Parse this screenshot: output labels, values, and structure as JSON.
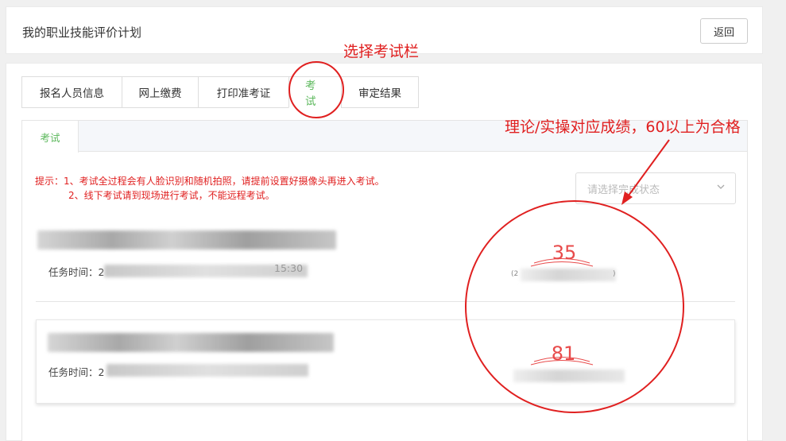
{
  "header": {
    "title": "我的职业技能评价计划",
    "back_label": "返回"
  },
  "tabs": [
    {
      "label": "报名人员信息",
      "active": false
    },
    {
      "label": "网上缴费",
      "active": false
    },
    {
      "label": "打印准考证",
      "active": false
    },
    {
      "label": "考试",
      "active": true
    },
    {
      "label": "审定结果",
      "active": false
    }
  ],
  "subtab": {
    "label": "考试"
  },
  "tips": {
    "line1": "提示：1、考试全过程会有人脸识别和随机拍照，请提前设置好摄像头再进入考试。",
    "line2": "2、线下考试请到现场进行考试，不能远程考试。"
  },
  "status_select": {
    "placeholder": "请选择完成状态",
    "chevron_icon": "chevron-down-icon"
  },
  "tasks": [
    {
      "time_label": "任务时间：2",
      "time_tail": "15:30",
      "score": "35",
      "score_paren_left": "(2",
      "score_paren_right": ")"
    },
    {
      "time_label": "任务时间：2",
      "score": "81"
    }
  ],
  "annotations": {
    "tab_hint": "选择考试栏",
    "score_hint": "理论/实操对应成绩，60以上为合格"
  },
  "colors": {
    "accent_green": "#5cb85c",
    "annotation_red": "#e02020",
    "score_red": "#e84a4a"
  }
}
